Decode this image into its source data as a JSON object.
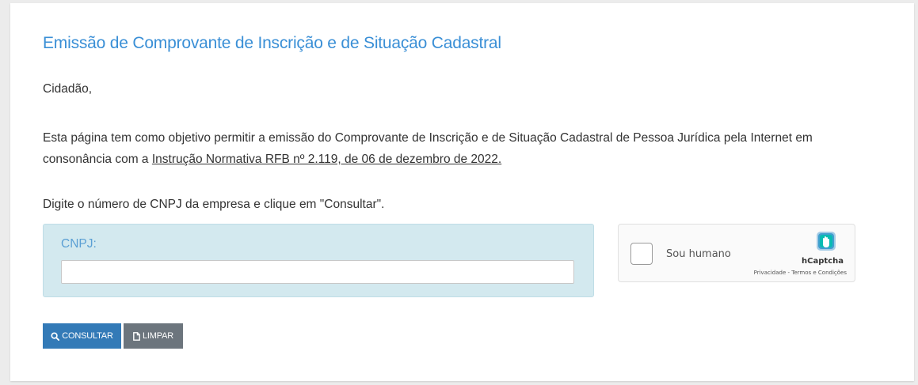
{
  "page": {
    "title": "Emissão de Comprovante de Inscrição e de Situação Cadastral",
    "greeting": "Cidadão,",
    "paragraph_before_link": "Esta página tem como objetivo permitir a emissão do Comprovante de Inscrição e de Situação Cadastral de Pessoa Jurídica pela Internet em consonância com a ",
    "paragraph_link": "Instrução Normativa RFB nº 2.119, de 06 de dezembro de 2022.",
    "instruction": "Digite o número de CNPJ da empresa e clique em \"Consultar\"."
  },
  "form": {
    "cnpj_label": "CNPJ:",
    "cnpj_value": "",
    "cnpj_placeholder": ""
  },
  "captcha": {
    "checkbox_label": "Sou humano",
    "brand": "hCaptcha",
    "privacy_link": "Privacidade",
    "separator": " - ",
    "terms_link": "Termos e Condições",
    "logo_icon": "hcaptcha-hand-icon"
  },
  "buttons": {
    "consultar_label": "CONSULTAR",
    "consultar_icon": "search-icon",
    "limpar_label": "LIMPAR",
    "limpar_icon": "document-icon"
  },
  "colors": {
    "title": "#3a8fd6",
    "cnpj_panel": "#d3e9ef",
    "consultar_button": "#337ab7",
    "limpar_button": "#6c757d"
  }
}
